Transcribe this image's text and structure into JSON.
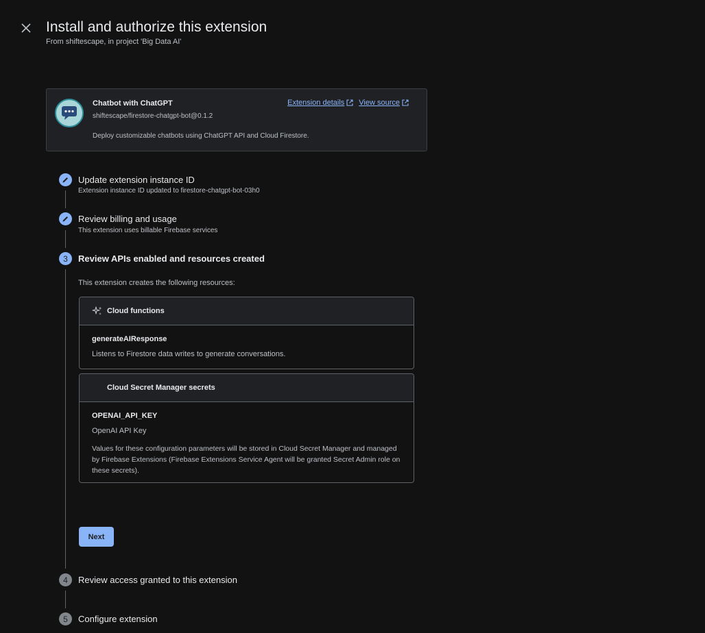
{
  "header": {
    "title": "Install and authorize this extension",
    "subtitle": "From shiftescape, in project 'Big Data AI'"
  },
  "extension": {
    "name": "Chatbot with ChatGPT",
    "ref": "shiftescape/firestore-chatgpt-bot@0.1.2",
    "description": "Deploy customizable chatbots using ChatGPT API and Cloud Firestore.",
    "details_link": "Extension details",
    "source_link": "View source"
  },
  "steps": [
    {
      "title": "Update extension instance ID",
      "summary": "Extension instance ID updated to firestore-chatgpt-bot-03h0",
      "status": "done"
    },
    {
      "title": "Review billing and usage",
      "summary": "This extension uses billable Firebase services",
      "status": "done"
    },
    {
      "number": "3",
      "title": "Review APIs enabled and resources created",
      "status": "active"
    },
    {
      "number": "4",
      "title": "Review access granted to this extension",
      "status": "pending"
    },
    {
      "number": "5",
      "title": "Configure extension",
      "status": "pending"
    }
  ],
  "resources": {
    "intro": "This extension creates the following resources:",
    "functions": {
      "header": "Cloud functions",
      "name": "generateAIResponse",
      "description": "Listens to Firestore data writes to generate conversations."
    },
    "secrets": {
      "header": "Cloud Secret Manager secrets",
      "name": "OPENAI_API_KEY",
      "description": "OpenAI API Key",
      "note": "Values for these configuration parameters will be stored in Cloud Secret Manager and managed by Firebase Extensions (Firebase Extensions Service Agent will be granted Secret Admin role on these secrets)."
    }
  },
  "actions": {
    "next_label": "Next"
  },
  "colors": {
    "background": "#121212",
    "accent": "#8ab4f8",
    "card": "#202124"
  }
}
